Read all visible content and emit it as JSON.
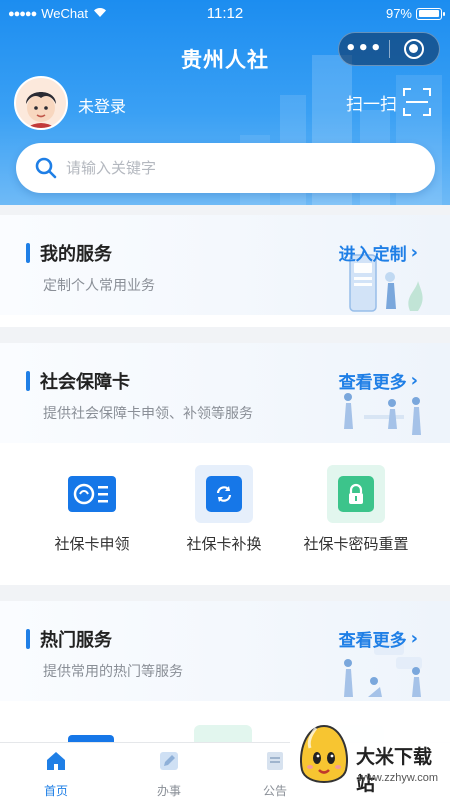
{
  "status_bar": {
    "signal": "●●●●●",
    "carrier": "WeChat",
    "time": "11:12",
    "battery": "97%",
    "battery_level": 0.97
  },
  "header": {
    "title": "贵州人社",
    "capsule_more": "•••",
    "login_text": "未登录",
    "scan_label": "扫一扫",
    "search_placeholder": "请输入关键字"
  },
  "sections": [
    {
      "title": "我的服务",
      "subtitle": "定制个人常用业务",
      "action": "进入定制"
    },
    {
      "title": "社会保障卡",
      "subtitle": "提供社会保障卡申领、补领等服务",
      "action": "查看更多",
      "services": [
        {
          "label": "社保卡申领",
          "icon": "social-security-card-icon"
        },
        {
          "label": "社保卡补换",
          "icon": "card-replace-icon"
        },
        {
          "label": "社保卡密码重置",
          "icon": "lock-icon"
        }
      ]
    },
    {
      "title": "热门服务",
      "subtitle": "提供常用的热门等服务",
      "action": "查看更多"
    }
  ],
  "tabbar": {
    "items": [
      {
        "label": "首页",
        "icon": "home-icon",
        "active": true
      },
      {
        "label": "办事",
        "icon": "pencil-icon",
        "active": false
      },
      {
        "label": "公告",
        "icon": "notice-icon",
        "active": false
      }
    ]
  },
  "watermark": {
    "text": "大米下载站",
    "url": "www.zzhyw.com"
  },
  "colors": {
    "accent": "#1f7fe6",
    "header_top": "#1c8df0",
    "card_icon_blue": "#1677e8",
    "card_icon_green": "#3cc48b"
  }
}
